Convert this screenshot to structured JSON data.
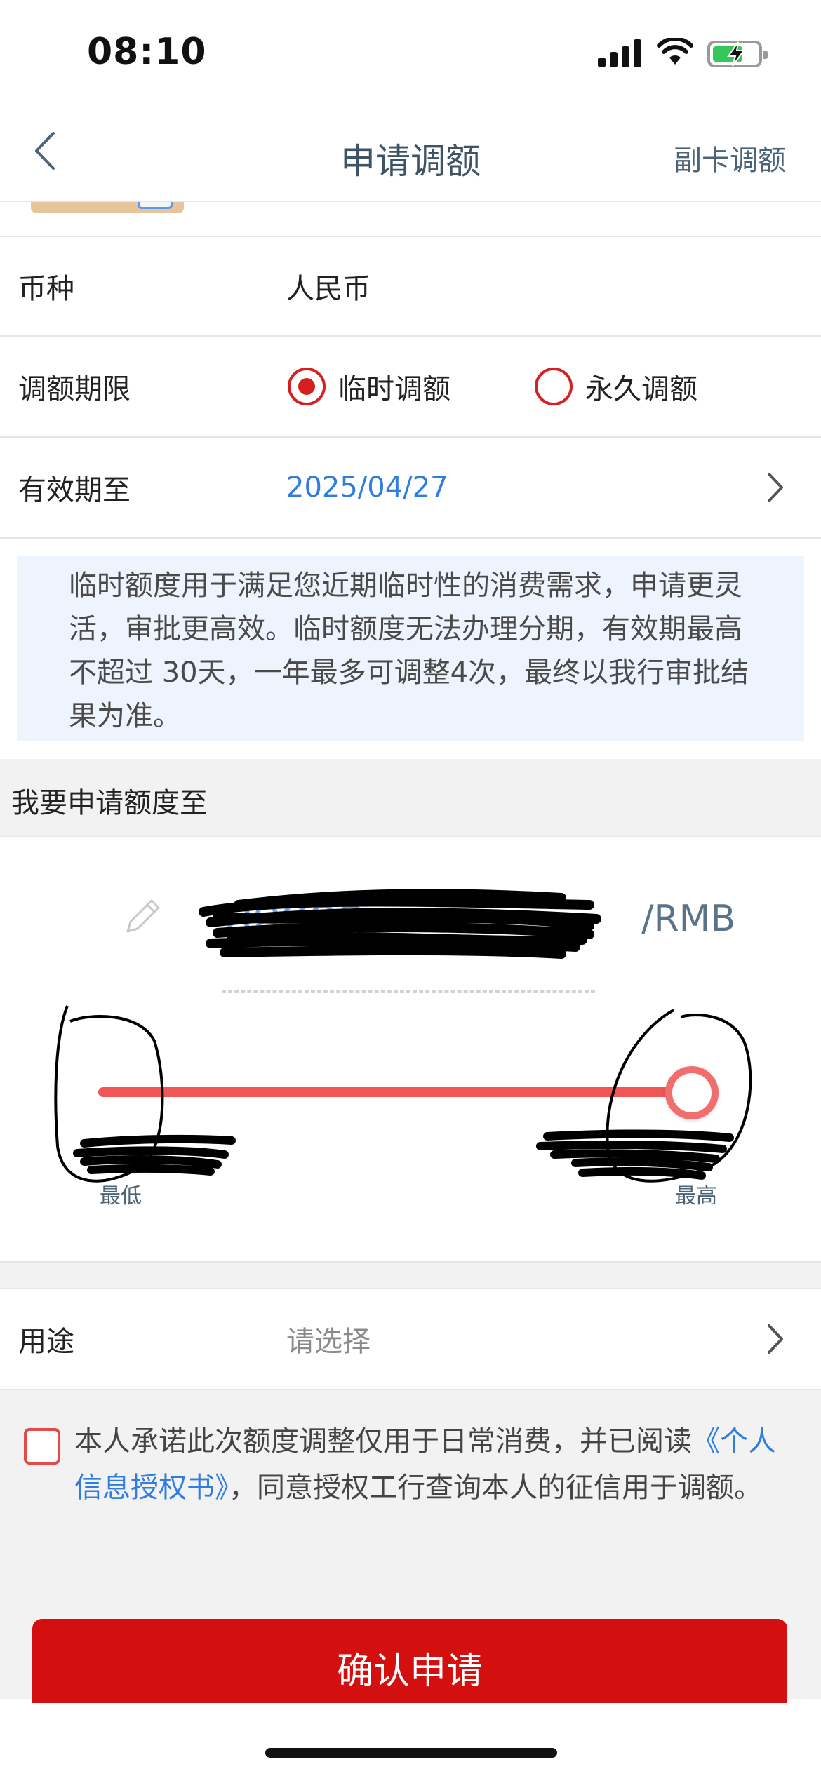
{
  "status_bar": {
    "time": "08:10"
  },
  "nav": {
    "title": "申请调额",
    "right_action": "副卡调额"
  },
  "currency": {
    "label": "币种",
    "value": "人民币"
  },
  "period": {
    "label": "调额期限",
    "options": [
      {
        "label": "临时调额",
        "selected": true
      },
      {
        "label": "永久调额",
        "selected": false
      }
    ]
  },
  "validity": {
    "label": "有效期至",
    "value": "2025/04/27"
  },
  "notice": "临时额度用于满足您近期临时性的消费需求，申请更灵活，审批更高效。临时额度无法办理分期，有效期最高不超过 30天，一年最多可调整4次，最终以我行审批结果为准。",
  "amount_section": {
    "title": "我要申请额度至",
    "unit": "/RMB",
    "slider_level": 1.0,
    "min_label": "最低",
    "max_label": "最高"
  },
  "purpose": {
    "label": "用途",
    "placeholder": "请选择"
  },
  "consent": {
    "text_before": "本人承诺此次额度调整仅用于日常消费，并已阅读",
    "link": "《个人信息授权书》",
    "text_after": "，同意授权工行查询本人的征信用于调额。"
  },
  "confirm_button": "确认申请",
  "colors": {
    "accent_red": "#d40f0f",
    "link_blue": "#2f7de1",
    "notice_bg": "#eef4fd"
  }
}
